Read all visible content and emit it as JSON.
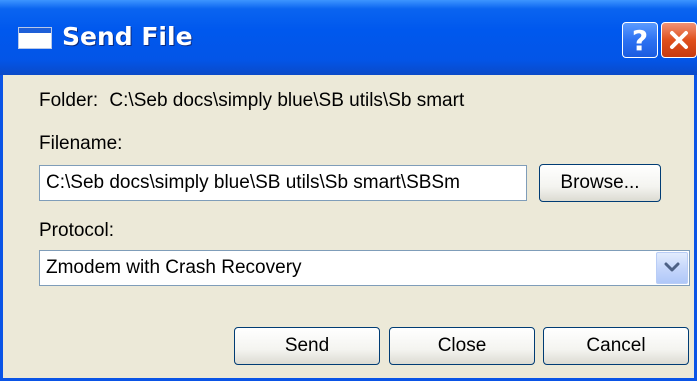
{
  "window": {
    "title": "Send File",
    "help_glyph": "?"
  },
  "folder": {
    "label": "Folder:",
    "path": "C:\\Seb docs\\simply blue\\SB utils\\Sb smart"
  },
  "filename": {
    "label": "Filename:",
    "value": "C:\\Seb docs\\simply blue\\SB utils\\Sb smart\\SBSm"
  },
  "browse_label": "Browse...",
  "protocol": {
    "label": "Protocol:",
    "selected": "Zmodem with Crash Recovery"
  },
  "actions": {
    "send": "Send",
    "close": "Close",
    "cancel": "Cancel"
  },
  "colors": {
    "titlebar": "#0058ee",
    "dialog_bg": "#ece9d8",
    "close_button": "#e0501c"
  },
  "icons": [
    "window-icon",
    "help-icon",
    "close-icon",
    "chevron-down-icon"
  ]
}
